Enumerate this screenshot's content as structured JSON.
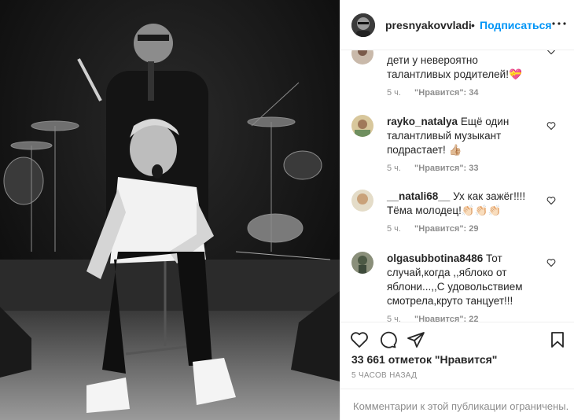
{
  "post": {
    "username": "presnyakovvladimi",
    "dot": "•",
    "follow_label": "Подписаться",
    "more_icon": "ellipsis-icon",
    "photo_alt": "photo"
  },
  "comments": [
    {
      "username": "",
      "text": "дети у невероятно талантливых родителей!💝",
      "age": "5 ч.",
      "likes": "\"Нравится\": 34"
    },
    {
      "username": "rayko_natalya",
      "text": "Ещё один талантливый музыкант подрастает! 👍🏼",
      "age": "5 ч.",
      "likes": "\"Нравится\": 33"
    },
    {
      "username": "__natali68__",
      "text": "Ух как зажёг!!!! Тёма молодец!👏🏻👏🏻👏🏻",
      "age": "5 ч.",
      "likes": "\"Нравится\": 29"
    },
    {
      "username": "olgasubbotina8486",
      "text": "Тот случай,когда ,,яблоко от яблони...,,С удовольствием смотрела,круто танцует!!!",
      "age": "5 ч.",
      "likes": "\"Нравится\": 22"
    }
  ],
  "actions": {
    "like_icon": "heart-icon",
    "comment_icon": "comment-bubble-icon",
    "share_icon": "paper-plane-icon",
    "save_icon": "bookmark-icon"
  },
  "likes_total": "33 661 отметок \"Нравится\"",
  "time_ago": "5 часов назад",
  "comments_disabled": "Комментарии к этой публикации ограничены."
}
